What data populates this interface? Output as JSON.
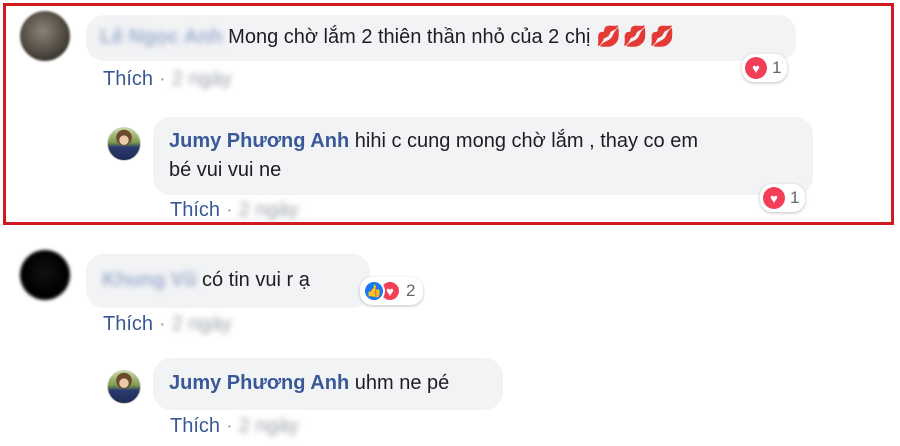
{
  "comments": [
    {
      "author": "Lê Ngọc Anh",
      "text": "Mong chờ lắm 2 thiên thần nhỏ của 2 chị",
      "emoji": "💋💋💋",
      "action": "Thích",
      "time": "2 ngày",
      "reaction_count": "1",
      "reply": {
        "author": "Jumy Phương Anh",
        "text_line1": "hihi c cung mong chờ lắm , thay co em",
        "text_line2": "bé vui vui ne",
        "action": "Thích",
        "time": "2 ngày",
        "reaction_count": "1"
      }
    },
    {
      "author": "Khung Vũ",
      "text": "có tin vui r ạ",
      "action": "Thích",
      "time": "2 ngày",
      "reaction_count": "2",
      "reply": {
        "author": "Jumy Phương Anh",
        "text": "uhm ne pé",
        "action": "Thích",
        "time": "2 ngày"
      }
    }
  ],
  "colors": {
    "highlight": "#d11a1f",
    "link": "#385898",
    "bubble": "#f2f3f5",
    "heart": "#f33e58",
    "like": "#1877f2"
  }
}
